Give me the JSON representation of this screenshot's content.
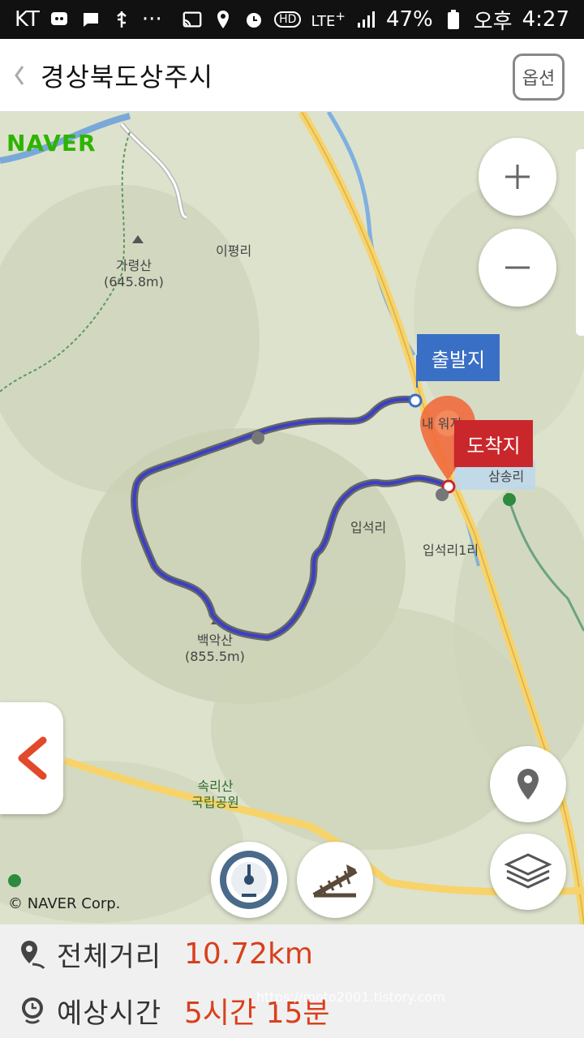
{
  "status_bar": {
    "carrier": "KT",
    "dots": "···",
    "network": "LTE",
    "network_sup": "+",
    "hd": "HD",
    "battery": "47%",
    "ampm": "오후",
    "time": "4:27"
  },
  "header": {
    "title": "경상북도상주시",
    "option_label": "옵션"
  },
  "map": {
    "brand": "NAVER",
    "places": {
      "ipyeong": "이평리",
      "garyeong_name": "가령산",
      "garyeong_height": "(645.8m)",
      "baegak_name": "백악산",
      "baegak_height": "(855.5m)",
      "ipseok": "입석리",
      "ipseok1": "입석리1리",
      "samsong": "삼송리",
      "songnisan_line1": "속리산",
      "songnisan_line2": "국립공원",
      "naeuji": "내 워지"
    },
    "start_flag": "출발지",
    "end_flag": "도착지",
    "copyright": "© NAVER Corp.",
    "route_color": "#3a3fc9",
    "start_color": "#3a6fc6",
    "end_color": "#c9272b"
  },
  "summary": {
    "distance_label": "전체거리",
    "distance_value": "10.72km",
    "time_label": "예상시간",
    "time_value": "5시간 15분",
    "watermark": "https://moto2001.tistory.com"
  }
}
